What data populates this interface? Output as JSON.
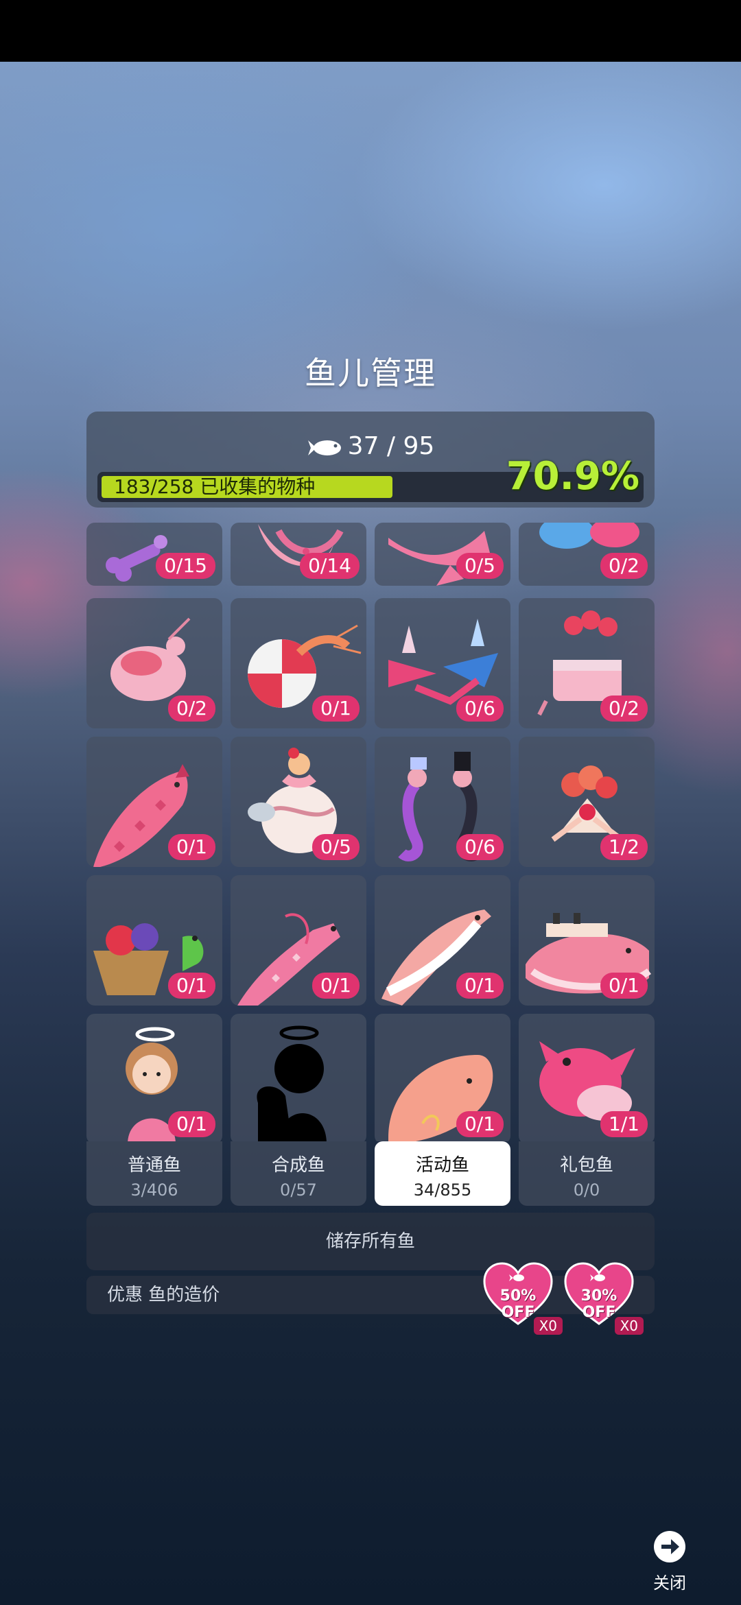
{
  "header": {
    "title": "鱼儿管理",
    "fish_count": "37 / 95",
    "collected_text": "183/258 已收集的物种",
    "collected_fraction": 0.709,
    "percent": "70.9%"
  },
  "grid": {
    "cells": [
      {
        "name": "bone-fish",
        "count": "0/15"
      },
      {
        "name": "pink-ribbon-fish",
        "count": "0/14"
      },
      {
        "name": "bow-fish",
        "count": "0/5"
      },
      {
        "name": "jelly-pair",
        "count": "0/2"
      },
      {
        "name": "pink-shrimp",
        "count": "0/2"
      },
      {
        "name": "candy-shrimp",
        "count": "0/1"
      },
      {
        "name": "party-lobsters",
        "count": "0/6"
      },
      {
        "name": "cake-crab",
        "count": "0/2"
      },
      {
        "name": "heart-arowana",
        "count": "0/1"
      },
      {
        "name": "dessert-fish",
        "count": "0/5"
      },
      {
        "name": "seahorse-couple",
        "count": "0/6"
      },
      {
        "name": "bouquet-fish",
        "count": "1/2"
      },
      {
        "name": "basket-turtle",
        "count": "0/1"
      },
      {
        "name": "ribbon-eel",
        "count": "0/1"
      },
      {
        "name": "pink-shark",
        "count": "0/1"
      },
      {
        "name": "ship-whale",
        "count": "0/1"
      },
      {
        "name": "angel-girl",
        "count": "0/1"
      },
      {
        "name": "locked-angel",
        "count": ""
      },
      {
        "name": "sperm-whale",
        "count": "0/1"
      },
      {
        "name": "pink-orca",
        "count": "1/1"
      }
    ]
  },
  "tabs": [
    {
      "label": "普通鱼",
      "count": "3/406"
    },
    {
      "label": "合成鱼",
      "count": "0/57"
    },
    {
      "label": "活动鱼",
      "count": "34/855"
    },
    {
      "label": "礼包鱼",
      "count": "0/0"
    }
  ],
  "active_tab": 2,
  "store_all_label": "储存所有鱼",
  "discount": {
    "label": "优惠 鱼的造价",
    "coupons": [
      {
        "line1": "50%",
        "line2": "OFF",
        "qty": "X0"
      },
      {
        "line1": "30%",
        "line2": "OFF",
        "qty": "X0"
      }
    ]
  },
  "close_label": "关闭",
  "colors": {
    "accent_green": "#b8f038",
    "badge_pink": "#e0336f",
    "bar_fill": "#b7d81f"
  }
}
